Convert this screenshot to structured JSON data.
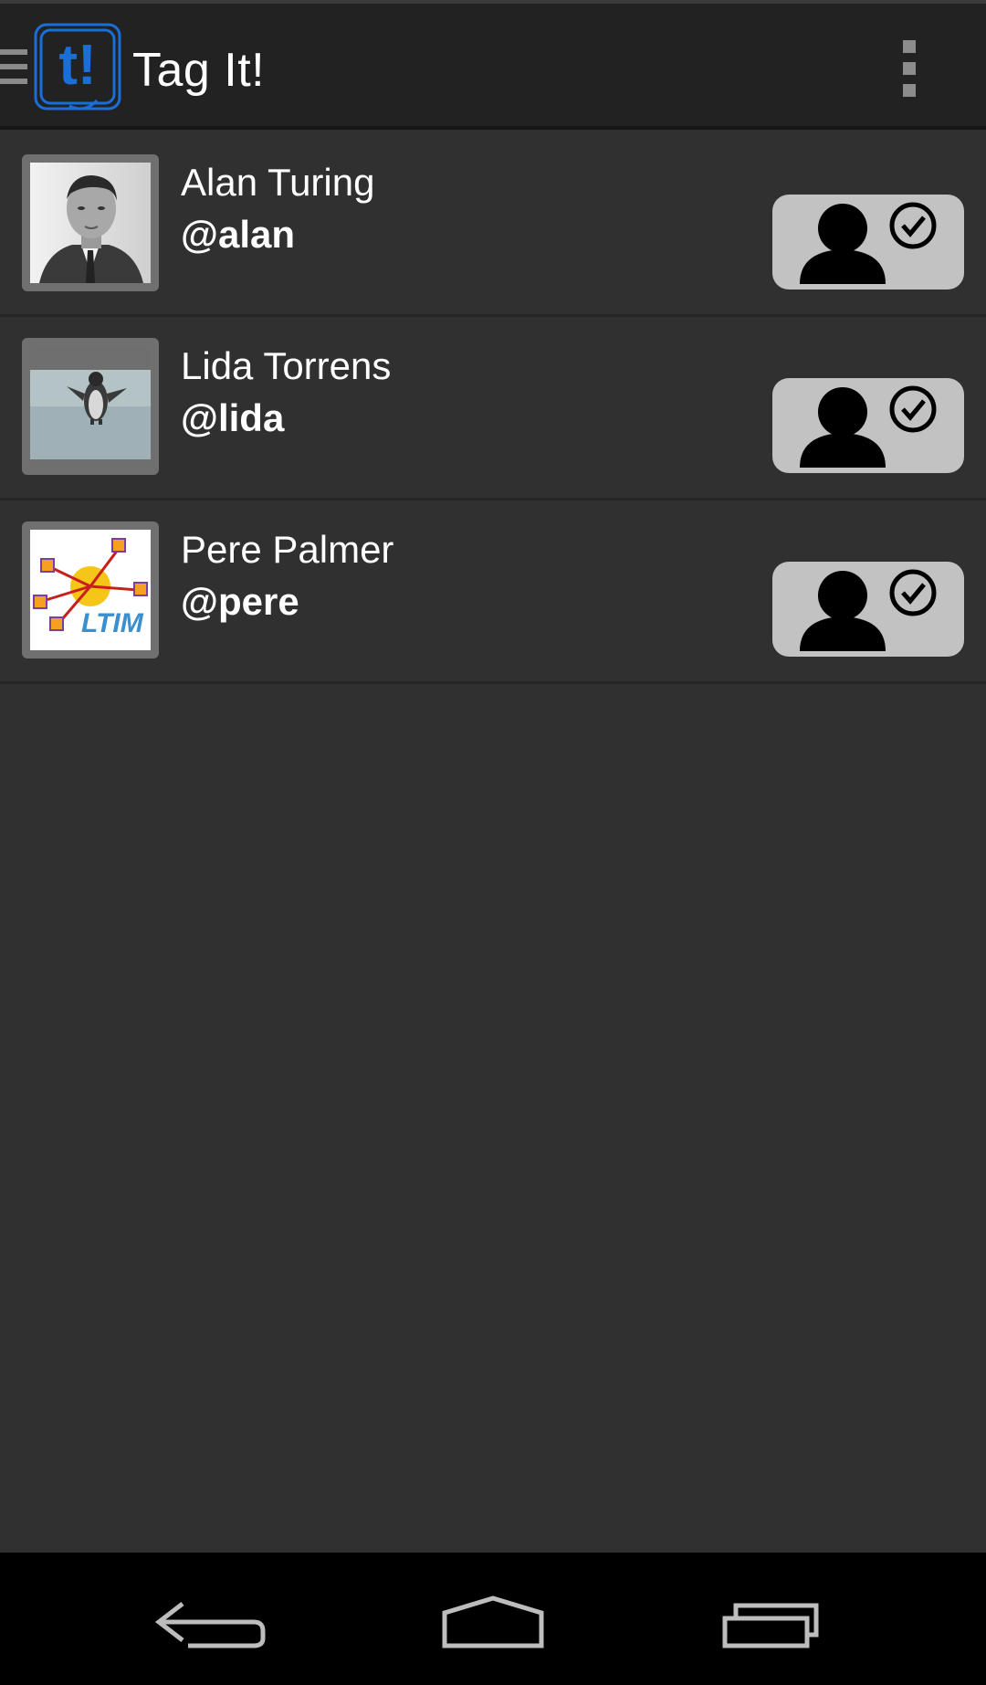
{
  "app": {
    "title": "Tag It!",
    "logo_text": "t!",
    "accent_color": "#1a6fd6"
  },
  "actionbar": {
    "drawer_icon": "drawer-menu-icon",
    "overflow_icon": "overflow-menu-icon"
  },
  "users": [
    {
      "name": "Alan Turing",
      "handle": "@alan",
      "avatar": "portrait-photo",
      "action_icon": "user-followed-icon"
    },
    {
      "name": "Lida Torrens",
      "handle": "@lida",
      "avatar": "penguin-photo",
      "action_icon": "user-followed-icon"
    },
    {
      "name": "Pere Palmer",
      "handle": "@pere",
      "avatar": "ltim-logo",
      "action_icon": "user-followed-icon"
    }
  ],
  "navbar": {
    "back_icon": "back-icon",
    "home_icon": "home-icon",
    "recents_icon": "recents-icon"
  },
  "colors": {
    "background": "#303030",
    "actionbar": "#222222",
    "button_bg": "#c2c2c2"
  }
}
